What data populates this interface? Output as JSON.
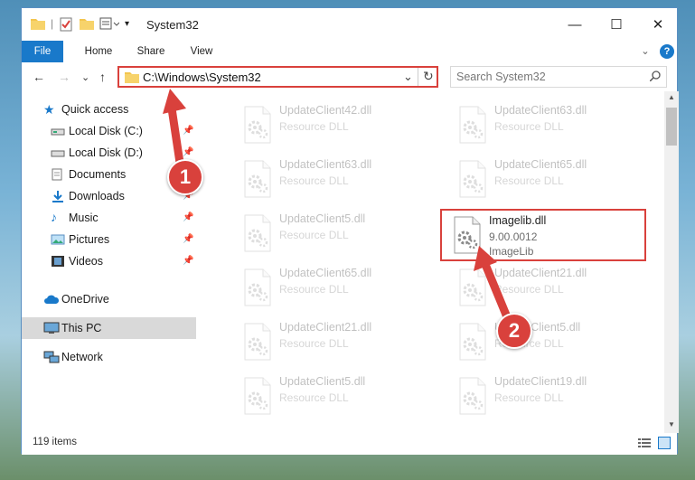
{
  "window": {
    "title": "System32",
    "controls": {
      "minimize": "—",
      "maximize": "☐",
      "close": "✕"
    }
  },
  "ribbon": {
    "tabs": [
      "File",
      "Home",
      "Share",
      "View"
    ],
    "expand": "⌄",
    "help": "?"
  },
  "address": {
    "path": "C:\\Windows\\System32",
    "dropdown": "⌄",
    "refresh": "↻"
  },
  "search": {
    "placeholder": "Search System32"
  },
  "nav": {
    "back": "←",
    "forward": "→",
    "recent": "⌄",
    "up": "↑",
    "quick_access": "Quick access",
    "items": [
      {
        "label": "Local Disk (C:)",
        "icon": "drive-icon",
        "pinned": true
      },
      {
        "label": "Local Disk (D:)",
        "icon": "drive-icon",
        "pinned": true
      },
      {
        "label": "Documents",
        "icon": "documents-icon",
        "pinned": true
      },
      {
        "label": "Downloads",
        "icon": "downloads-icon",
        "pinned": true
      },
      {
        "label": "Music",
        "icon": "music-icon",
        "pinned": true
      },
      {
        "label": "Pictures",
        "icon": "pictures-icon",
        "pinned": true
      },
      {
        "label": "Videos",
        "icon": "videos-icon",
        "pinned": true
      }
    ],
    "onedrive": "OneDrive",
    "this_pc": "This PC",
    "network": "Network"
  },
  "files": [
    {
      "name": "UpdateClient42.dll",
      "sub1": "Resource DLL",
      "sub2": ""
    },
    {
      "name": "UpdateClient63.dll",
      "sub1": "Resource DLL",
      "sub2": ""
    },
    {
      "name": "UpdateClient63.dll",
      "sub1": "Resource DLL",
      "sub2": ""
    },
    {
      "name": "UpdateClient65.dll",
      "sub1": "Resource DLL",
      "sub2": ""
    },
    {
      "name": "UpdateClient5.dll",
      "sub1": "Resource DLL",
      "sub2": ""
    },
    {
      "name": "Imagelib.dll",
      "sub1": "9.00.0012",
      "sub2": "ImageLib",
      "highlight": true
    },
    {
      "name": "UpdateClient65.dll",
      "sub1": "Resource DLL",
      "sub2": ""
    },
    {
      "name": "UpdateClient21.dll",
      "sub1": "Resource DLL",
      "sub2": ""
    },
    {
      "name": "UpdateClient21.dll",
      "sub1": "Resource DLL",
      "sub2": ""
    },
    {
      "name": "UpdateClient5.dll",
      "sub1": "Resource DLL",
      "sub2": ""
    },
    {
      "name": "UpdateClient5.dll",
      "sub1": "Resource DLL",
      "sub2": ""
    },
    {
      "name": "UpdateClient19.dll",
      "sub1": "Resource DLL",
      "sub2": ""
    }
  ],
  "status": {
    "count": "119 items"
  },
  "annotations": {
    "step1": "1",
    "step2": "2"
  },
  "colors": {
    "accent": "#1979ca",
    "highlight": "#d9413c"
  }
}
